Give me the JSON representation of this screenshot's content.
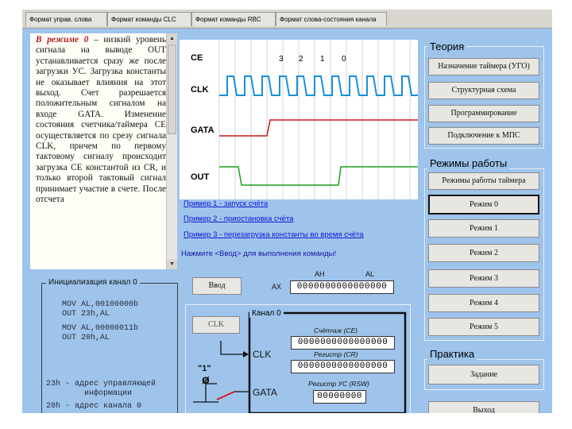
{
  "tabs": [
    "Формат управ. слова",
    "Формат команды CLC",
    "Формат команды RBC",
    "Формат слова-состояния канала"
  ],
  "theory_text": {
    "lead": "В режиме 0",
    "body": " – низкий уровень сигнала на выводе OUT устанавливается сразу же после загрузки УС. Загрузка константы не оказывает влияния на этот выход. Счет разрешается положительным сигналом на входе GATA. Изменение состояния счетчика/таймера СЕ осуществляется по срезу сигнала CLK, причем по первому тактовому сигналу происходит загрузка СЕ константой из CR, и только второй тактовый сигнал принимает участие в счете. После отсчета"
  },
  "timing": {
    "signals": [
      "CE",
      "CLK",
      "GATA",
      "OUT"
    ],
    "ce_counts": [
      "3",
      "2",
      "1",
      "0"
    ]
  },
  "examples": [
    "Пример 1 - запуск счёта",
    "Пример 2 - приостановка счёта",
    "Пример 3 - перезагрузка константы во время счёта"
  ],
  "hint": "Нажмите <Ввод> для выполнения команды!",
  "theory": {
    "title": "Теория",
    "buttons": [
      "Назначение таймера (УГО)",
      "Структурная схема",
      "Программирование",
      "Подключение к МПС"
    ]
  },
  "modes": {
    "title": "Режимы работы",
    "header_button": "Режимы работы таймера",
    "buttons": [
      "Режим 0",
      "Режим 1",
      "Режим 2",
      "Режим 3",
      "Режим 4",
      "Режим 5"
    ],
    "active_index": 0
  },
  "practice": {
    "title": "Практика",
    "button": "Задание"
  },
  "exit_button": "Выход",
  "init": {
    "title": "Инициализация канал 0",
    "code": [
      "MOV AL,00100000b",
      "OUT 23h,AL",
      "MOV AL,00000011b",
      "OUT 20h,AL"
    ],
    "notes": [
      "23h - адрес управляющей",
      "        информации",
      "20h - адрес канала 0"
    ]
  },
  "enter_button": "Ввод",
  "ax": {
    "label": "AX",
    "ah_label": "AH",
    "al_label": "AL",
    "value": "0000000000000000"
  },
  "channel": {
    "title": "Канал 0",
    "clk_button": "CLK",
    "clk_label": "CLK",
    "gata_label": "GATA",
    "gata_level": "\"1\"",
    "counter_label": "Счётчик (CE)",
    "counter_value": "0000000000000000",
    "register_label": "Регистр (CR)",
    "register_value": "0000000000000000",
    "control_label": "Регистр УС (RSW)",
    "control_value": "00000000"
  },
  "colors": {
    "panel_bg": "#9ec4ec",
    "clk_wave": "#1a8fd8",
    "gata_wave": "#c81818",
    "out_wave": "#1aa01a",
    "link": "#1414d2"
  }
}
